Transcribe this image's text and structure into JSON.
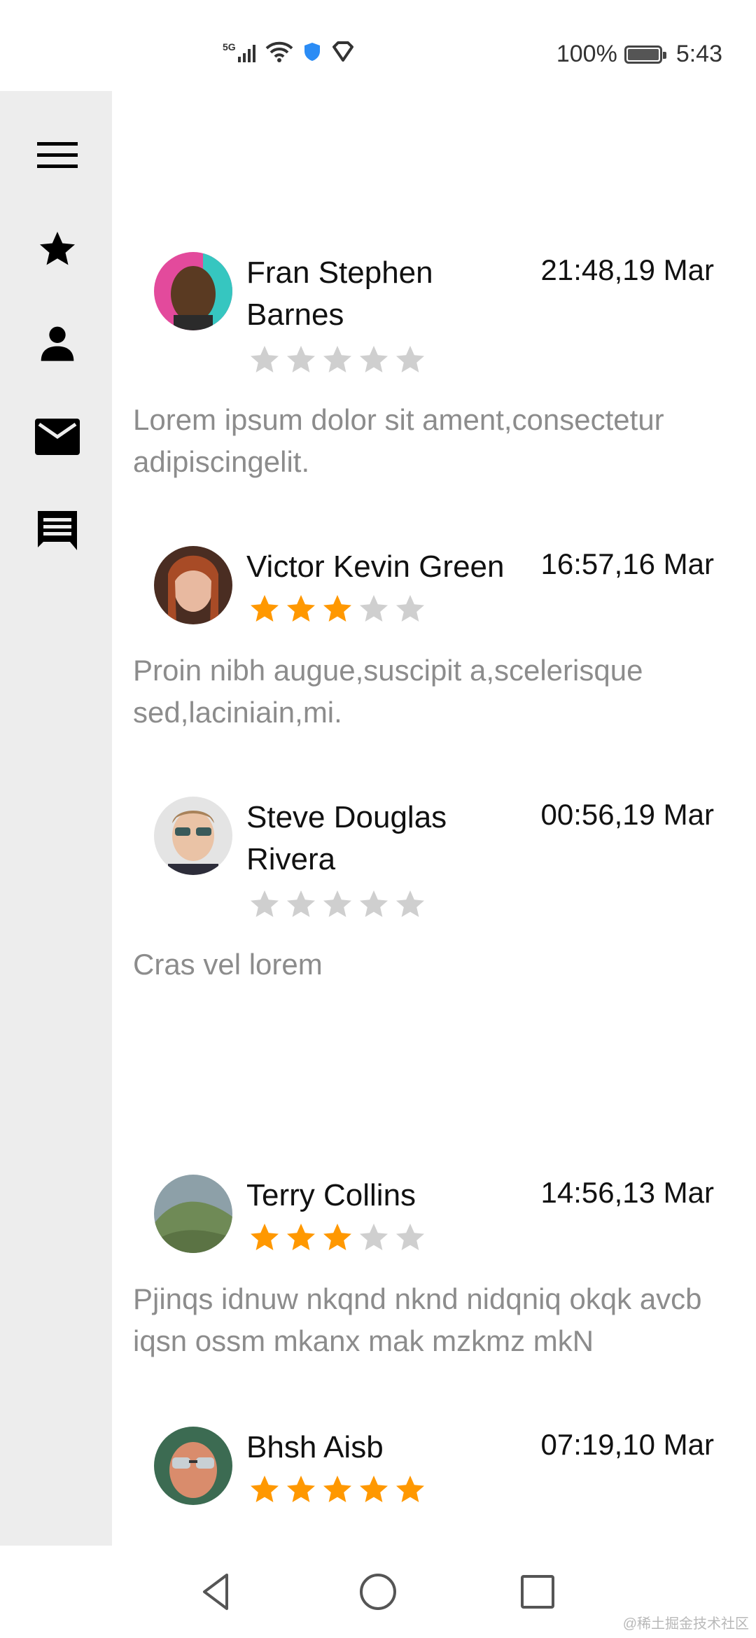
{
  "status_bar": {
    "network": "5G",
    "battery": "100%",
    "time": "5:43"
  },
  "sidebar": {
    "items": [
      {
        "icon": "menu-icon"
      },
      {
        "icon": "star-icon"
      },
      {
        "icon": "person-icon"
      },
      {
        "icon": "mail-icon"
      },
      {
        "icon": "chat-icon"
      }
    ]
  },
  "reviews": [
    {
      "name": "Fran Stephen Barnes",
      "time": "21:48,19 Mar",
      "rating": 0,
      "comment": "Lorem ipsum dolor sit ament,consectetur adipiscingelit."
    },
    {
      "name": "Victor Kevin Green",
      "time": "16:57,16 Mar",
      "rating": 3,
      "comment": "Proin nibh augue,suscipit a,scelerisque sed,laciniain,mi."
    },
    {
      "name": "Steve Douglas Rivera",
      "time": "00:56,19 Mar",
      "rating": 0,
      "comment": "Cras vel lorem"
    },
    {
      "name": "Terry Collins",
      "time": "14:56,13 Mar",
      "rating": 3,
      "comment": "Pjinqs idnuw nkqnd nknd nidqniq okqk avcb iqsn ossm mkanx mak mzkmz mkN"
    },
    {
      "name": "Bhsh Aisb",
      "time": "07:19,10 Mar",
      "rating": 5,
      "comment": ""
    }
  ],
  "colors": {
    "star_filled": "#FF9800",
    "star_empty": "#CFCFCF",
    "sidebar_bg": "#EDEDED",
    "comment_text": "#8C8C8C"
  },
  "navbar": {
    "buttons": [
      "back-icon",
      "home-icon",
      "recents-icon"
    ]
  },
  "watermark": "@稀土掘金技术社区"
}
